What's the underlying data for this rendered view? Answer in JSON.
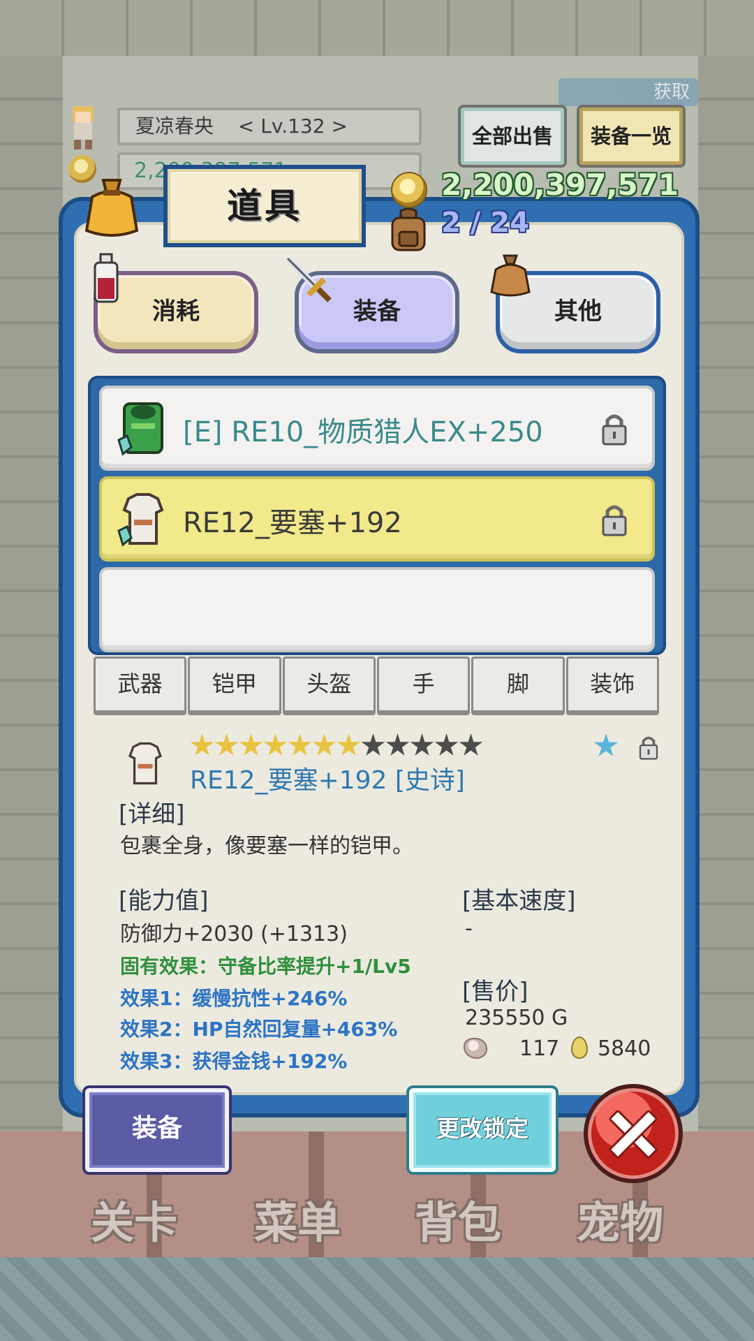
{
  "header": {
    "player_name": "夏凉春央",
    "player_level": "< Lv.132 >",
    "gold_partial": "2,200,397,571",
    "sell_all_label": "全部出售",
    "equip_list_label": "装备一览",
    "acquire_label": "获取"
  },
  "modal": {
    "title": "道具",
    "gold": "2,200,397,571",
    "capacity": "2 / 24"
  },
  "categories": [
    {
      "label": "消耗",
      "state": "normal"
    },
    {
      "label": "装备",
      "state": "selected"
    },
    {
      "label": "其他",
      "state": "normal"
    }
  ],
  "items": [
    {
      "name": "[E] RE10_物质猎人EX+250",
      "equipped": true,
      "icon": "green-armor-icon",
      "locked": true
    },
    {
      "name": "RE12_要塞+192",
      "equipped": false,
      "icon": "white-armor-icon",
      "locked": true,
      "selected": true
    }
  ],
  "slot_tabs": [
    "武器",
    "铠甲",
    "头盔",
    "手",
    "脚",
    "装饰"
  ],
  "detail": {
    "stars_on": 7,
    "stars_total": 12,
    "name": "RE12_要塞+192 [史诗]",
    "detail_heading": "[详细]",
    "description": "包裹全身，像要塞一样的铠甲。",
    "stats_heading": "[能力值]",
    "defense": "防御力+2030 (+1313)",
    "inherent_effect": "固有效果：守备比率提升+1/Lv5",
    "effects": [
      "效果1：缓慢抗性+246%",
      "效果2：HP自然回复量+463%",
      "效果3：获得金钱+192%"
    ],
    "speed_heading": "[基本速度]",
    "speed_value": "-",
    "price_heading": "[售价]",
    "price": "235550 G",
    "ore_count": "117",
    "drop_count": "5840"
  },
  "buttons": {
    "equip": "装备",
    "change_lock": "更改锁定"
  },
  "bottom_nav": [
    "关卡",
    "菜单",
    "背包",
    "宠物"
  ],
  "colors": {
    "panel_blue": "#2f6fb1",
    "selected_row": "#f1e98a",
    "effect_green": "#2f8f3c",
    "effect_blue": "#2d74c4",
    "item_name_blue": "#2f78b0"
  }
}
